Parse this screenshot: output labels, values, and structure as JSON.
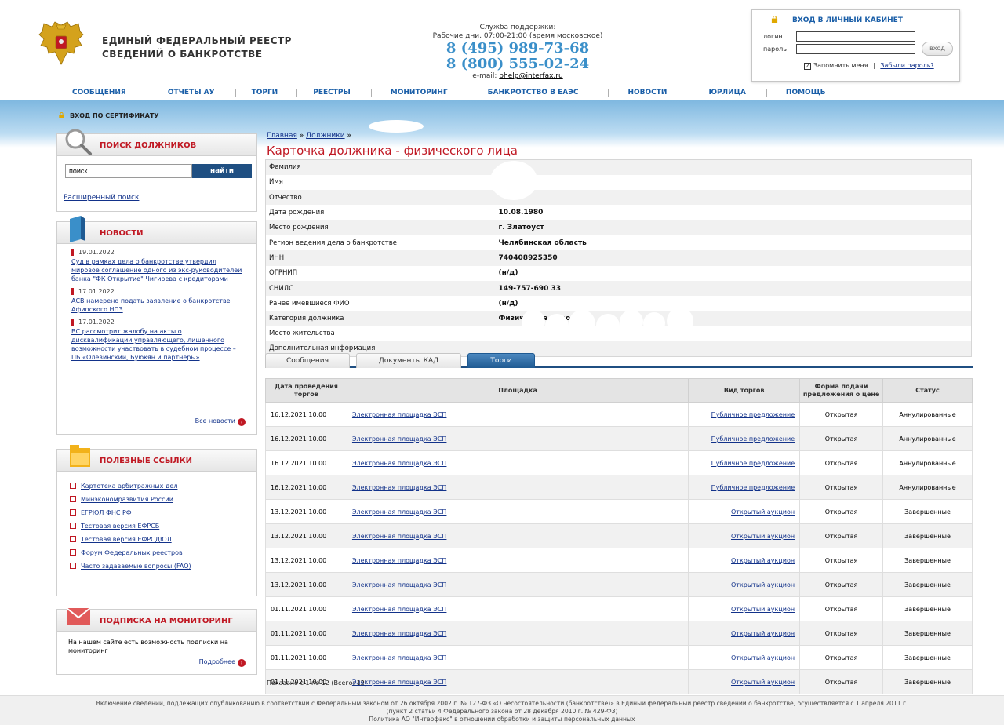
{
  "header": {
    "logo_line1": "ЕДИНЫЙ ФЕДЕРАЛЬНЫЙ РЕЕСТР",
    "logo_line2": "СВЕДЕНИЙ О БАНКРОТСТВЕ",
    "support_title": "Служба поддержки:",
    "support_hours": "Рабочие дни, 07:00-21:00 (время московское)",
    "phone1": "8 (495) 989-73-68",
    "phone2": "8 (800) 555-02-24",
    "email_label": "e-mail:",
    "email": "bhelp@interfax.ru"
  },
  "login": {
    "title": "ВХОД В ЛИЧНЫЙ КАБИНЕТ",
    "login_label": "логин",
    "password_label": "пароль",
    "login_value": "",
    "password_value": "",
    "button": "вход",
    "remember": "Запомнить меня",
    "separator": "|",
    "forgot": "Забыли пароль?"
  },
  "nav": [
    "СООБЩЕНИЯ",
    "ОТЧЕТЫ АУ",
    "ТОРГИ",
    "РЕЕСТРЫ",
    "МОНИТОРИНГ",
    "БАНКРОТСТВО В ЕАЭС",
    "НОВОСТИ",
    "ЮРЛИЦА",
    "ПОМОЩЬ"
  ],
  "cert_login": "ВХОД ПО СЕРТИФИКАТУ",
  "sidebar": {
    "search_title": "ПОИСК ДОЛЖНИКОВ",
    "search_value": "поиск",
    "search_button": "найти",
    "advanced_search": "Расширенный поиск",
    "news_title": "НОВОСТИ",
    "news": [
      {
        "date": "19.01.2022",
        "text": "Суд в рамках дела о банкротстве утвердил мировое соглашение одного из экс-руководителей банка \"ФК Открытие\" Чигирева с кредиторами"
      },
      {
        "date": "17.01.2022",
        "text": "АСВ намерено подать заявление о банкротстве Афипского НПЗ"
      },
      {
        "date": "17.01.2022",
        "text": "ВС рассмотрит жалобу на акты о дисквалификации управляющего, лишенного возможности участвовать в судебном процессе – ПБ «Олевинский, Буюкян и партнеры»"
      }
    ],
    "all_news": "Все новости",
    "links_title": "ПОЛЕЗНЫЕ ССЫЛКИ",
    "links": [
      "Картотека арбитражных дел",
      "Минэкономразвития России",
      "ЕГРЮЛ ФНС РФ",
      "Тестовая версия ЕФРСБ",
      "Тестовая версия ЕФРСДЮЛ",
      "Форум Федеральных реестров",
      "Часто задаваемые вопросы (FAQ)"
    ],
    "subscribe_title": "ПОДПИСКА НА МОНИТОРИНГ",
    "subscribe_text": "На нашем сайте есть возможность подписки на мониторинг",
    "subscribe_more": "Подробнее"
  },
  "breadcrumb": {
    "home": "Главная",
    "sep": "»",
    "debtors": "Должники",
    "sep2": "»"
  },
  "page_title": "Карточка должника - физического лица",
  "debtor": [
    {
      "key": "Фамилия",
      "value": ""
    },
    {
      "key": "Имя",
      "value": ""
    },
    {
      "key": "Отчество",
      "value": ""
    },
    {
      "key": "Дата рождения",
      "value": "10.08.1980"
    },
    {
      "key": "Место рождения",
      "value": "г. Златоуст"
    },
    {
      "key": "Регион ведения дела о банкротстве",
      "value": "Челябинская область"
    },
    {
      "key": "ИНН",
      "value": "740408925350"
    },
    {
      "key": "ОГРНИП",
      "value": "(н/д)"
    },
    {
      "key": "СНИЛС",
      "value": "149-757-690 33"
    },
    {
      "key": "Ранее имевшиеся ФИО",
      "value": "(н/д)"
    },
    {
      "key": "Категория должника",
      "value": "Физическое лицо"
    },
    {
      "key": "Место жительства",
      "value": ""
    },
    {
      "key": "Дополнительная информация",
      "value": ""
    }
  ],
  "tabs": [
    "Сообщения",
    "Документы КАД",
    "Торги"
  ],
  "trades_headers": [
    "Дата проведения торгов",
    "Площадка",
    "Вид торгов",
    "Форма подачи предложения о цене",
    "Статус"
  ],
  "trades": [
    {
      "date": "16.12.2021 10.00",
      "site": "Электронная площадка ЭСП",
      "type": "Публичное предложение",
      "form": "Открытая",
      "status": "Аннулированные"
    },
    {
      "date": "16.12.2021 10.00",
      "site": "Электронная площадка ЭСП",
      "type": "Публичное предложение",
      "form": "Открытая",
      "status": "Аннулированные"
    },
    {
      "date": "16.12.2021 10.00",
      "site": "Электронная площадка ЭСП",
      "type": "Публичное предложение",
      "form": "Открытая",
      "status": "Аннулированные"
    },
    {
      "date": "16.12.2021 10.00",
      "site": "Электронная площадка ЭСП",
      "type": "Публичное предложение",
      "form": "Открытая",
      "status": "Аннулированные"
    },
    {
      "date": "13.12.2021 10.00",
      "site": "Электронная площадка ЭСП",
      "type": "Открытый аукцион",
      "form": "Открытая",
      "status": "Завершенные"
    },
    {
      "date": "13.12.2021 10.00",
      "site": "Электронная площадка ЭСП",
      "type": "Открытый аукцион",
      "form": "Открытая",
      "status": "Завершенные"
    },
    {
      "date": "13.12.2021 10.00",
      "site": "Электронная площадка ЭСП",
      "type": "Открытый аукцион",
      "form": "Открытая",
      "status": "Завершенные"
    },
    {
      "date": "13.12.2021 10.00",
      "site": "Электронная площадка ЭСП",
      "type": "Открытый аукцион",
      "form": "Открытая",
      "status": "Завершенные"
    },
    {
      "date": "01.11.2021 10.00",
      "site": "Электронная площадка ЭСП",
      "type": "Открытый аукцион",
      "form": "Открытая",
      "status": "Завершенные"
    },
    {
      "date": "01.11.2021 10.00",
      "site": "Электронная площадка ЭСП",
      "type": "Открытый аукцион",
      "form": "Открытая",
      "status": "Завершенные"
    },
    {
      "date": "01.11.2021 10.00",
      "site": "Электронная площадка ЭСП",
      "type": "Открытый аукцион",
      "form": "Открытая",
      "status": "Завершенные"
    },
    {
      "date": "01.11.2021 10.00",
      "site": "Электронная площадка ЭСП",
      "type": "Открытый аукцион",
      "form": "Открытая",
      "status": "Завершенные"
    }
  ],
  "shown_text": "Показано с 1 по 12 (Всего: 12)",
  "footer": {
    "line1": "Включение сведений, подлежащих опубликованию в соответствии с Федеральным законом от 26 октября 2002 г. № 127-ФЗ «О несостоятельности (банкротстве)» в Единый федеральный реестр сведений о банкротстве, осуществляется с 1 апреля 2011 г.",
    "line2": "(пункт 2 статьи 4 Федерального закона от 28 декабря 2010 г. № 429-ФЗ)",
    "line3": "Политика АО \"Интерфакс\" в отношении обработки и защиты персональных данных"
  },
  "colors": {
    "accent_red": "#c01823",
    "nav_blue": "#1b5fa8",
    "phone_blue": "#3a8fc9",
    "tab_active": "#1f5a92"
  }
}
